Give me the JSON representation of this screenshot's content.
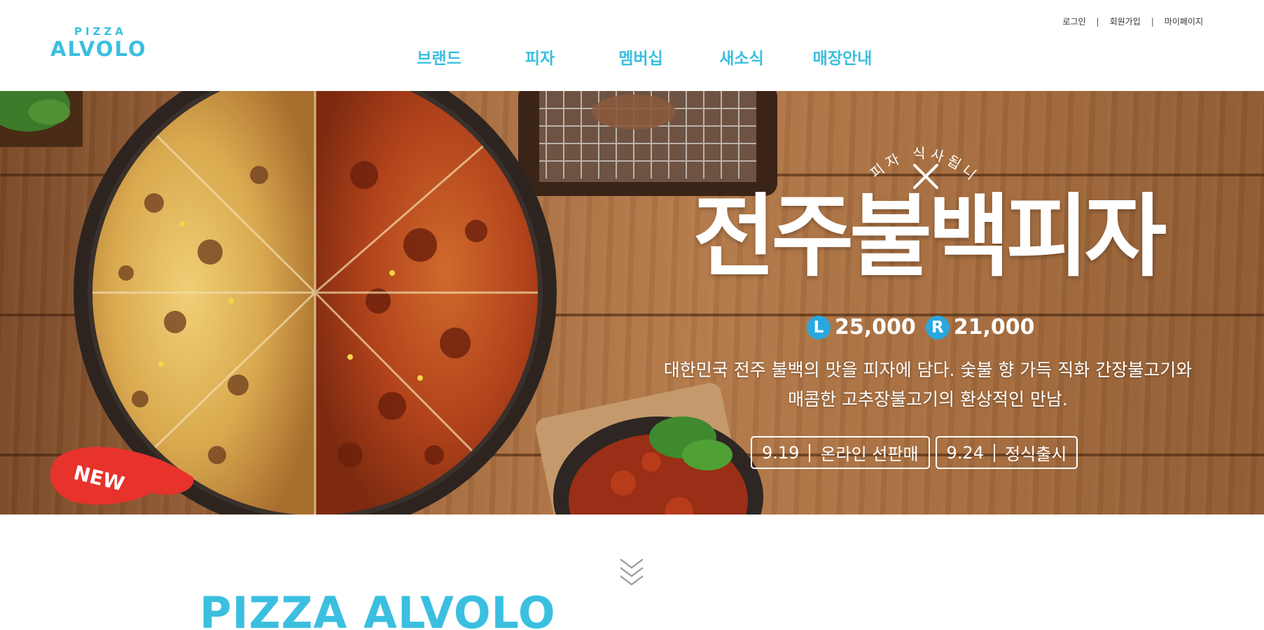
{
  "header": {
    "logo": {
      "small": "PIZZA",
      "big": "ALVOLO"
    },
    "nav": [
      {
        "label": "브랜드"
      },
      {
        "label": "피자"
      },
      {
        "label": "멤버십"
      },
      {
        "label": "새소식"
      },
      {
        "label": "매장안내"
      }
    ],
    "util": {
      "login": "로그인",
      "join": "회원가입",
      "mypage": "마이페이지",
      "separator": "|"
    }
  },
  "hero": {
    "tagline": "피자 식사됩니다",
    "title": "전주불백피자",
    "prices": [
      {
        "size": "L",
        "price": "25,000"
      },
      {
        "size": "R",
        "price": "21,000"
      }
    ],
    "description_line1": "대한민국 전주 불백의 맛을 피자에 담다. 숯불 향 가득 직화 간장불고기와",
    "description_line2": "매콤한 고추장불고기의 환상적인 만남.",
    "dates": [
      {
        "date": "9.19",
        "label": "온라인 선판매"
      },
      {
        "date": "9.24",
        "label": "정식출시"
      }
    ],
    "new_badge": "NEW"
  },
  "section": {
    "title": "PIZZA ALVOLO"
  },
  "colors": {
    "brand": "#3bbfe0",
    "price_badge": "#29a8df",
    "new_badge": "#e8322c"
  },
  "icons": {
    "scroll": "chevron-triple-down-icon",
    "tagline": "fork-knife-icon"
  }
}
